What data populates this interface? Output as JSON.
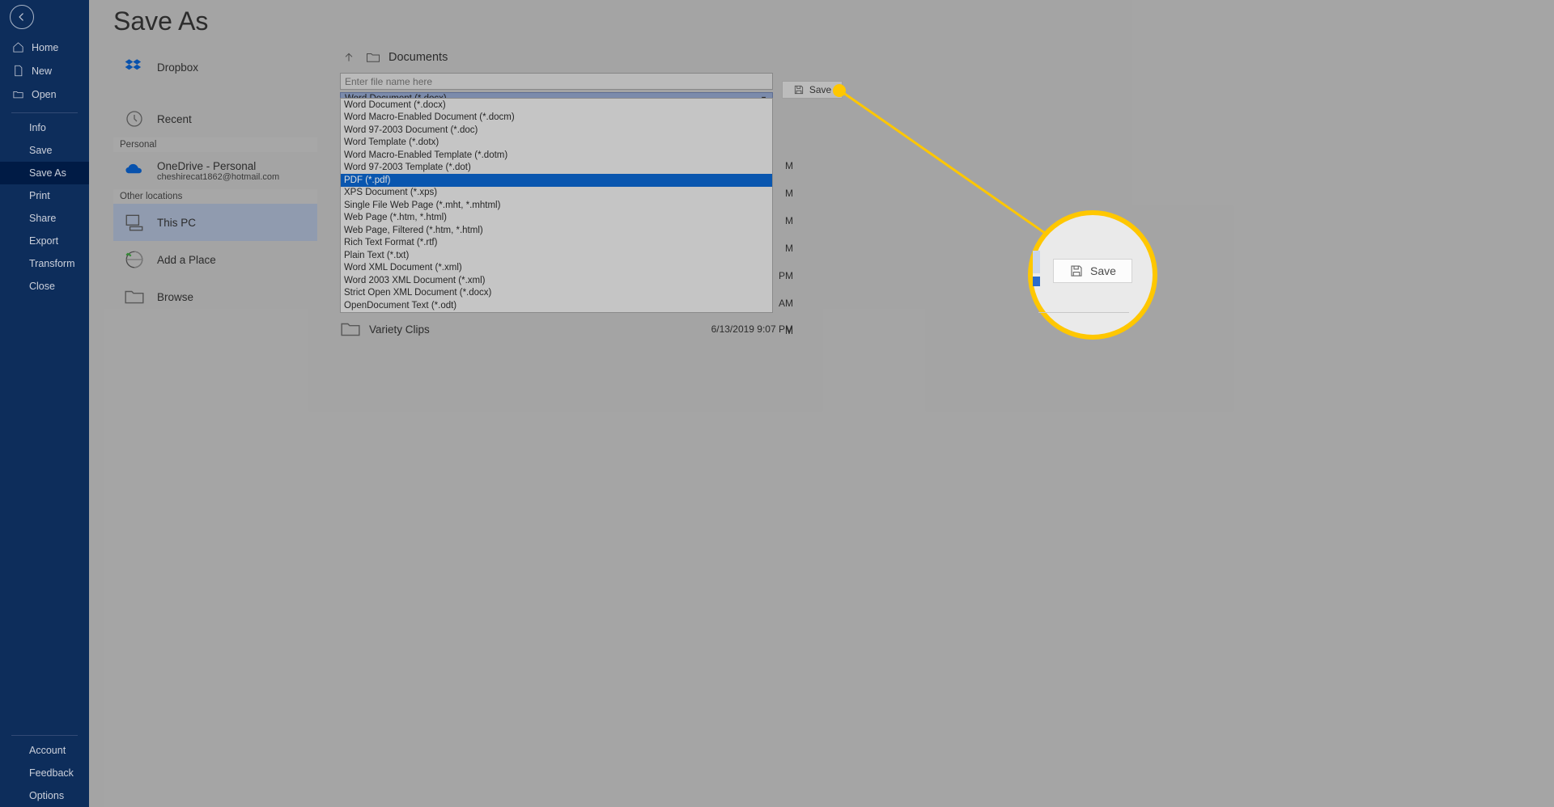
{
  "page_title": "Save As",
  "sidebar": {
    "top": [
      {
        "icon": "home",
        "label": "Home"
      },
      {
        "icon": "doc",
        "label": "New"
      },
      {
        "icon": "folder-open",
        "label": "Open"
      }
    ],
    "middle": [
      {
        "label": "Info"
      },
      {
        "label": "Save"
      },
      {
        "label": "Save As",
        "active": true
      },
      {
        "label": "Print"
      },
      {
        "label": "Share"
      },
      {
        "label": "Export"
      },
      {
        "label": "Transform"
      },
      {
        "label": "Close"
      }
    ],
    "bottom": [
      {
        "label": "Account"
      },
      {
        "label": "Feedback"
      },
      {
        "label": "Options"
      }
    ]
  },
  "locations": {
    "items": [
      {
        "icon": "dropbox",
        "label": "Dropbox"
      },
      {
        "icon": "recent",
        "label": "Recent"
      }
    ],
    "header_personal": "Personal",
    "onedrive": {
      "label": "OneDrive - Personal",
      "sub": "cheshirecat1862@hotmail.com"
    },
    "header_other": "Other locations",
    "other": [
      {
        "icon": "thispc",
        "label": "This PC",
        "selected": true
      },
      {
        "icon": "addplace",
        "label": "Add a Place"
      },
      {
        "icon": "browse",
        "label": "Browse"
      }
    ]
  },
  "breadcrumb": "Documents",
  "filename_placeholder": "Enter file name here",
  "filetype_selected": "Word Document (*.docx)",
  "filetype_options": [
    "Word Document (*.docx)",
    "Word Macro-Enabled Document (*.docm)",
    "Word 97-2003 Document (*.doc)",
    "Word Template (*.dotx)",
    "Word Macro-Enabled Template (*.dotm)",
    "Word 97-2003 Template (*.dot)",
    "PDF (*.pdf)",
    "XPS Document (*.xps)",
    "Single File Web Page (*.mht, *.mhtml)",
    "Web Page (*.htm, *.html)",
    "Web Page, Filtered (*.htm, *.html)",
    "Rich Text Format (*.rtf)",
    "Plain Text (*.txt)",
    "Word XML Document (*.xml)",
    "Word 2003 XML Document (*.xml)",
    "Strict Open XML Document (*.docx)",
    "OpenDocument Text (*.odt)"
  ],
  "filetype_highlight_index": 6,
  "save_label": "Save",
  "file_rows": [
    {
      "name": "",
      "date_suffix": "M"
    },
    {
      "name": "",
      "date_suffix": "M"
    },
    {
      "name": "",
      "date_suffix": "M"
    },
    {
      "name": "",
      "date_suffix": "M"
    },
    {
      "name": "",
      "date_suffix": "PM"
    },
    {
      "name": "",
      "date_suffix": "AM"
    },
    {
      "name": "",
      "date_suffix": "M"
    }
  ],
  "visible_file": {
    "name": "Variety Clips",
    "date": "6/13/2019 9:07 PM"
  },
  "callout": {
    "save_label": "Save"
  }
}
